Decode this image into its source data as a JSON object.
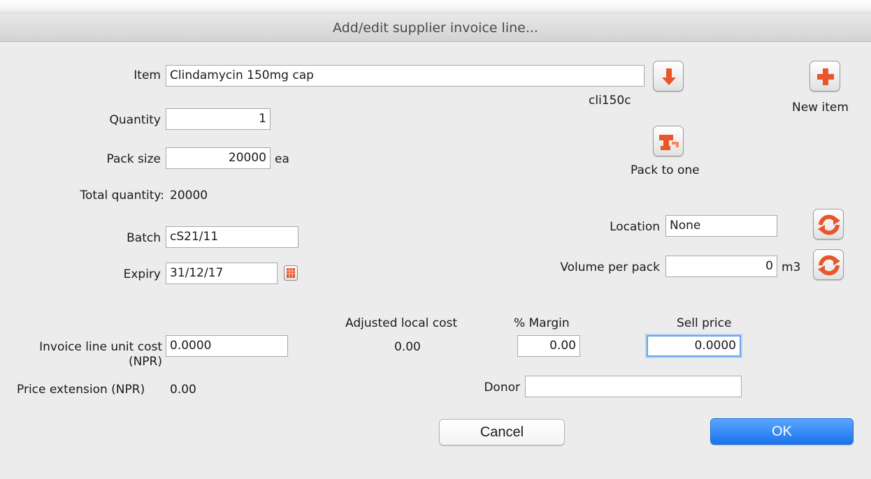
{
  "window": {
    "title": "Add/edit supplier invoice line..."
  },
  "item": {
    "label": "Item",
    "value": "Clindamycin 150mg cap",
    "code": "cli150c"
  },
  "quantity": {
    "label": "Quantity",
    "value": "1"
  },
  "pack_size": {
    "label": "Pack size",
    "value": "20000",
    "unit": "ea"
  },
  "total_quantity": {
    "label": "Total quantity:",
    "value": "20000"
  },
  "batch": {
    "label": "Batch",
    "value": "cS21/11"
  },
  "expiry": {
    "label": "Expiry",
    "value": "31/12/17"
  },
  "location": {
    "label": "Location",
    "value": "None"
  },
  "volume_per_pack": {
    "label": "Volume per pack",
    "value": "0",
    "unit": "m3"
  },
  "buttons": {
    "new_item": "New item",
    "pack_to_one": "Pack to one",
    "cancel": "Cancel",
    "ok": "OK"
  },
  "pricing": {
    "unit_cost_label_1": "Invoice line unit cost",
    "unit_cost_label_2": "(NPR)",
    "unit_cost_value": "0.0000",
    "adjusted_local_cost_label": "Adjusted local cost",
    "adjusted_local_cost_value": "0.00",
    "margin_label": "% Margin",
    "margin_value": "0.00",
    "sell_price_label": "Sell price",
    "sell_price_value": "0.0000",
    "price_extension_label": "Price extension (NPR)",
    "price_extension_value": "0.00"
  },
  "donor": {
    "label": "Donor",
    "value": ""
  },
  "icons": {
    "item_lookup": "arrow-down-icon",
    "new_item": "plus-icon",
    "pack_to_one": "pack-to-one-icon",
    "location_refresh": "refresh-icon",
    "volume_refresh": "refresh-icon",
    "calendar": "calendar-icon"
  },
  "colors": {
    "accent": "#e8562a",
    "ok_button": "#1a74ea",
    "focus_ring": "#6aa4ea"
  }
}
